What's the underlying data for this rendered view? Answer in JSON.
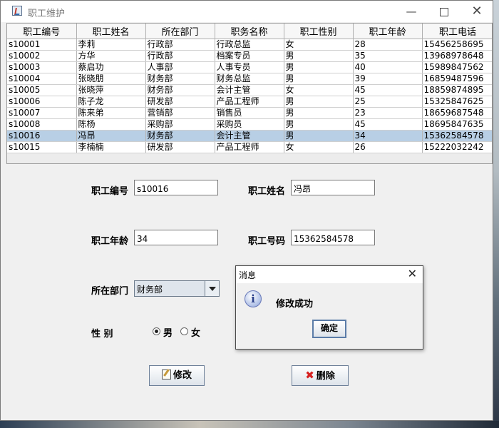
{
  "window": {
    "title": "职工维护"
  },
  "table": {
    "headers": [
      "职工编号",
      "职工姓名",
      "所在部门",
      "职务名称",
      "职工性别",
      "职工年龄",
      "职工电话"
    ],
    "rows": [
      [
        "s10001",
        "李莉",
        "行政部",
        "行政总监",
        "女",
        "28",
        "15456258695"
      ],
      [
        "s10002",
        "方华",
        "行政部",
        "档案专员",
        "男",
        "35",
        "13968978648"
      ],
      [
        "s10003",
        "蔡启功",
        "人事部",
        "人事专员",
        "男",
        "40",
        "15989847562"
      ],
      [
        "s10004",
        "张晓朋",
        "财务部",
        "财务总监",
        "男",
        "39",
        "16859487596"
      ],
      [
        "s10005",
        "张晓萍",
        "财务部",
        "会计主管",
        "女",
        "45",
        "18859874895"
      ],
      [
        "s10006",
        "陈子龙",
        "研发部",
        "产品工程师",
        "男",
        "25",
        "15325847625"
      ],
      [
        "s10007",
        "陈来弟",
        "营销部",
        "销售员",
        "男",
        "23",
        "18659687548"
      ],
      [
        "s10008",
        "陈杨",
        "采购部",
        "采购员",
        "男",
        "45",
        "18695847635"
      ],
      [
        "s10016",
        "冯昂",
        "财务部",
        "会计主管",
        "男",
        "34",
        "15362584578"
      ],
      [
        "s10015",
        "李楠楠",
        "研发部",
        "产品工程师",
        "女",
        "26",
        "15222032242"
      ]
    ],
    "selected_row": 8
  },
  "form": {
    "id_label": "职工编号",
    "id_value": "s10016",
    "name_label": "职工姓名",
    "name_value": "冯昂",
    "age_label": "职工年龄",
    "age_value": "34",
    "phone_label": "职工号码",
    "phone_value": "15362584578",
    "dept_label": "所在部门",
    "dept_value": "财务部",
    "gender_label": "性 别",
    "gender_male": "男",
    "gender_female": "女",
    "gender_selected": "男"
  },
  "buttons": {
    "edit_label": "修改",
    "delete_label": "删除"
  },
  "dialog": {
    "title": "消息",
    "message": "修改成功",
    "ok_label": "确定"
  }
}
